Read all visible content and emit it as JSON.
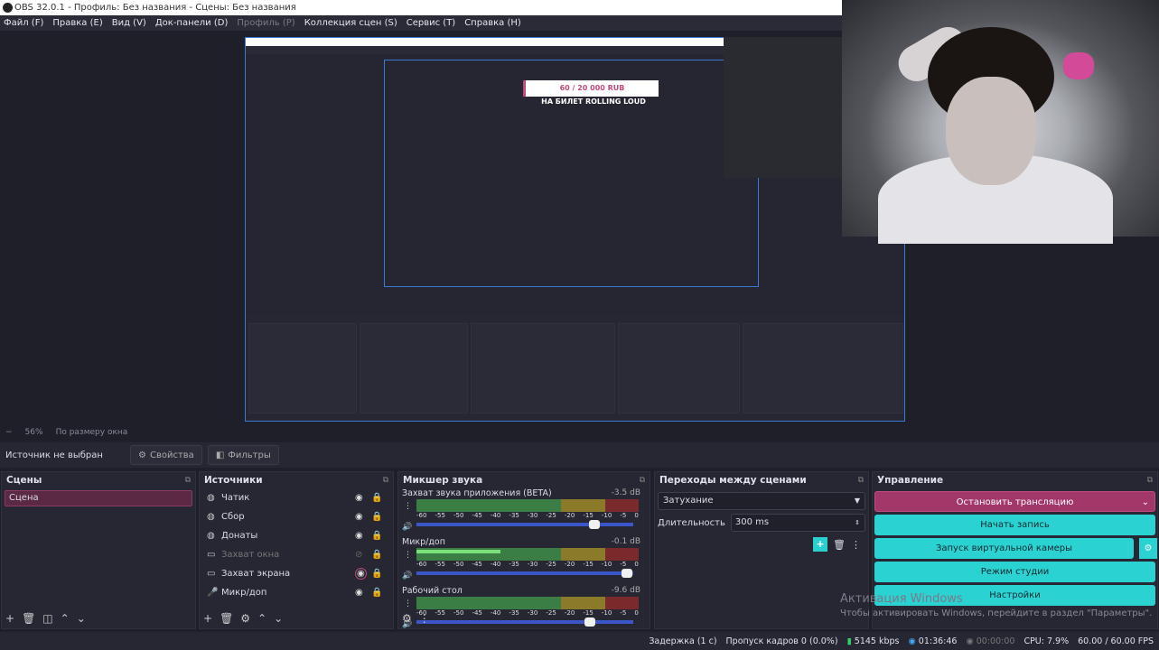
{
  "window_title": "OBS 32.0.1 - Профиль: Без названия - Сцены: Без названия",
  "menu": [
    {
      "label": "Файл (F)",
      "enabled": true
    },
    {
      "label": "Правка (E)",
      "enabled": true
    },
    {
      "label": "Вид (V)",
      "enabled": true
    },
    {
      "label": "Док-панели (D)",
      "enabled": true
    },
    {
      "label": "Профиль (P)",
      "enabled": false
    },
    {
      "label": "Коллекция сцен (S)",
      "enabled": true
    },
    {
      "label": "Сервис (T)",
      "enabled": true
    },
    {
      "label": "Справка (H)",
      "enabled": true
    }
  ],
  "zoom": {
    "minus": "−",
    "percent": "56%",
    "mode": "По размеру окна"
  },
  "preview_overlay": {
    "donation": "60 / 20 000 RUB",
    "caption": "НА БИЛЕТ ROLLING LOUD"
  },
  "source_bar": {
    "no_source": "Источник не выбран",
    "properties": "Свойства",
    "filters": "Фильтры"
  },
  "scenes": {
    "title": "Сцены",
    "items": [
      "Сцена"
    ]
  },
  "sources": {
    "title": "Источники",
    "items": [
      {
        "name": "Чатик",
        "icon": "browser-icon",
        "visible": true,
        "dim": false,
        "highlight": false
      },
      {
        "name": "Сбор",
        "icon": "browser-icon",
        "visible": true,
        "dim": false,
        "highlight": false
      },
      {
        "name": "Донаты",
        "icon": "browser-icon",
        "visible": true,
        "dim": false,
        "highlight": false
      },
      {
        "name": "Захват окна",
        "icon": "window-icon",
        "visible": false,
        "dim": true,
        "highlight": false
      },
      {
        "name": "Захват экрана",
        "icon": "monitor-icon",
        "visible": true,
        "dim": false,
        "highlight": true
      },
      {
        "name": "Микр/доп",
        "icon": "mic-icon",
        "visible": true,
        "dim": false,
        "highlight": false
      }
    ]
  },
  "mixer": {
    "title": "Микшер звука",
    "ticks": [
      "-60",
      "-55",
      "-50",
      "-45",
      "-40",
      "-35",
      "-30",
      "-25",
      "-20",
      "-15",
      "-10",
      "-5",
      "0"
    ],
    "channels": [
      {
        "name": "Захват звука приложения (BETA)",
        "db": "-3.5 dB",
        "level": 0,
        "volume": 0.82
      },
      {
        "name": "Микр/доп",
        "db": "-0.1 dB",
        "level": 0.38,
        "volume": 0.97
      },
      {
        "name": "Рабочий стол",
        "db": "-9.6 dB",
        "level": 0,
        "volume": 0.8
      }
    ]
  },
  "transitions": {
    "title": "Переходы между сценами",
    "selected": "Затухание",
    "duration_label": "Длительность",
    "duration": "300 ms"
  },
  "controls": {
    "title": "Управление",
    "stop_stream": "Остановить трансляцию",
    "start_record": "Начать запись",
    "virtual_cam": "Запуск виртуальной камеры",
    "studio_mode": "Режим студии",
    "settings": "Настройки"
  },
  "watermark": {
    "line1": "Активация Windows",
    "line2": "Чтобы активировать Windows, перейдите в раздел \"Параметры\"."
  },
  "status": {
    "delay": "Задержка (1 с)",
    "dropped": "Пропуск кадров 0 (0.0%)",
    "bitrate": "5145 kbps",
    "stream_time": "01:36:46",
    "rec_time": "00:00:00",
    "cpu": "CPU: 7.9%",
    "fps": "60.00 / 60.00 FPS"
  },
  "colors": {
    "accent": "#2bd2d2",
    "stop": "#a2376a",
    "scene_sel": "#5c2944"
  }
}
